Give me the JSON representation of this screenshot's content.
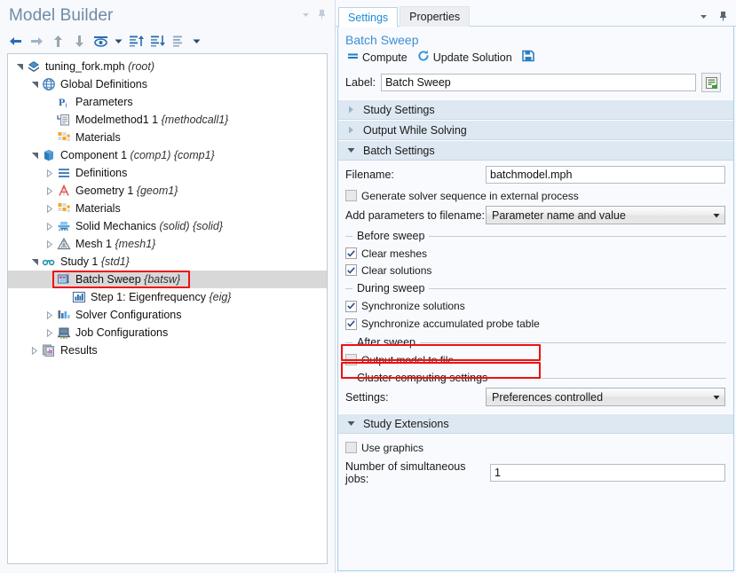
{
  "model_builder": {
    "title": "Model Builder",
    "header_controls": [
      {
        "name": "collapse-menu-icon",
        "glyph": "▼"
      },
      {
        "name": "pin-icon",
        "glyph": "pin"
      }
    ],
    "toolbar": [
      {
        "name": "back-icon",
        "tip": "Back"
      },
      {
        "name": "forward-icon",
        "tip": "Forward"
      },
      {
        "name": "move-up-icon",
        "tip": "Move Up"
      },
      {
        "name": "move-down-icon",
        "tip": "Move Down"
      },
      {
        "name": "show-icon",
        "tip": "Show"
      },
      {
        "name": "show-dropdown-icon",
        "tip": "Show options"
      },
      {
        "name": "expand-all-icon",
        "tip": "Expand All"
      },
      {
        "name": "collapse-all-icon",
        "tip": "Collapse All"
      },
      {
        "name": "tree-options-icon",
        "tip": "Tree options"
      },
      {
        "name": "tree-options-dropdown-icon",
        "tip": "Tree options menu"
      }
    ],
    "tree": [
      {
        "depth": 0,
        "twist": "expanded",
        "icon": "model-root-icon",
        "label": "tuning_fork.mph",
        "tag": "(root)",
        "selected": false,
        "highlight": false
      },
      {
        "depth": 1,
        "twist": "expanded",
        "icon": "global-definitions-icon",
        "label": "Global Definitions",
        "tag": "",
        "selected": false,
        "highlight": false
      },
      {
        "depth": 2,
        "twist": "none",
        "icon": "parameters-icon",
        "label": "Parameters",
        "tag": "",
        "selected": false,
        "highlight": false
      },
      {
        "depth": 2,
        "twist": "none",
        "icon": "method-call-icon",
        "label": "Modelmethod1 1",
        "tag": "{methodcall1}",
        "selected": false,
        "highlight": false
      },
      {
        "depth": 2,
        "twist": "none",
        "icon": "materials-icon",
        "label": "Materials",
        "tag": "",
        "selected": false,
        "highlight": false
      },
      {
        "depth": 1,
        "twist": "expanded",
        "icon": "component-icon",
        "label": "Component 1",
        "tag": "(comp1) {comp1}",
        "selected": false,
        "highlight": false
      },
      {
        "depth": 2,
        "twist": "collapsed",
        "icon": "definitions-icon",
        "label": "Definitions",
        "tag": "",
        "selected": false,
        "highlight": false
      },
      {
        "depth": 2,
        "twist": "collapsed",
        "icon": "geometry-icon",
        "label": "Geometry 1",
        "tag": "{geom1}",
        "selected": false,
        "highlight": false
      },
      {
        "depth": 2,
        "twist": "collapsed",
        "icon": "materials-icon",
        "label": "Materials",
        "tag": "",
        "selected": false,
        "highlight": false
      },
      {
        "depth": 2,
        "twist": "collapsed",
        "icon": "solid-mechanics-icon",
        "label": "Solid Mechanics",
        "tag": "(solid) {solid}",
        "selected": false,
        "highlight": false
      },
      {
        "depth": 2,
        "twist": "collapsed",
        "icon": "mesh-icon",
        "label": "Mesh 1",
        "tag": "{mesh1}",
        "selected": false,
        "highlight": false
      },
      {
        "depth": 1,
        "twist": "expanded",
        "icon": "study-icon",
        "label": "Study 1",
        "tag": "{std1}",
        "selected": false,
        "highlight": false
      },
      {
        "depth": 2,
        "twist": "none",
        "icon": "batch-sweep-icon",
        "label": "Batch Sweep",
        "tag": "{batsw}",
        "selected": true,
        "highlight": true
      },
      {
        "depth": 3,
        "twist": "none",
        "icon": "eigenfrequency-icon",
        "label": "Step 1: Eigenfrequency",
        "tag": "{eig}",
        "selected": false,
        "highlight": false
      },
      {
        "depth": 2,
        "twist": "collapsed",
        "icon": "solver-configurations-icon",
        "label": "Solver Configurations",
        "tag": "",
        "selected": false,
        "highlight": false
      },
      {
        "depth": 2,
        "twist": "collapsed",
        "icon": "job-configurations-icon",
        "label": "Job Configurations",
        "tag": "",
        "selected": false,
        "highlight": false
      },
      {
        "depth": 1,
        "twist": "collapsed",
        "icon": "results-icon",
        "label": "Results",
        "tag": "",
        "selected": false,
        "highlight": false
      }
    ]
  },
  "settings": {
    "tabs": [
      {
        "label": "Settings",
        "active": true
      },
      {
        "label": "Properties",
        "active": false
      }
    ],
    "header_controls": [
      {
        "name": "collapse-menu-icon",
        "glyph": "▼"
      },
      {
        "name": "pin-icon",
        "glyph": "pin"
      }
    ],
    "node_title": "Batch Sweep",
    "actions": [
      {
        "name": "compute-button",
        "label": "Compute",
        "icon": "equals-icon"
      },
      {
        "name": "update-solution-button",
        "label": "Update Solution",
        "icon": "refresh-icon"
      },
      {
        "name": "save-button",
        "label": "",
        "icon": "save-icon"
      }
    ],
    "label_field": {
      "label": "Label:",
      "value": "Batch Sweep",
      "button_icon": "rename-icon"
    },
    "sections": [
      {
        "title": "Study Settings",
        "expanded": false
      },
      {
        "title": "Output While Solving",
        "expanded": false
      },
      {
        "title": "Batch Settings",
        "expanded": true
      },
      {
        "title": "Study Extensions",
        "expanded": true
      }
    ],
    "batch_settings": {
      "filename_label": "Filename:",
      "filename_value": "batchmodel.mph",
      "generate_solver_label": "Generate solver sequence in external process",
      "generate_solver_checked": false,
      "add_params_label": "Add parameters to filename:",
      "add_params_value": "Parameter name and value",
      "group_before_sweep": "Before sweep",
      "clear_meshes_label": "Clear meshes",
      "clear_meshes_checked": true,
      "clear_solutions_label": "Clear solutions",
      "clear_solutions_checked": true,
      "group_during_sweep": "During sweep",
      "sync_solutions_label": "Synchronize solutions",
      "sync_solutions_checked": true,
      "sync_probe_label": "Synchronize accumulated probe table",
      "sync_probe_checked": true,
      "group_after_sweep": "After sweep",
      "output_model_label": "Output model to file",
      "output_model_checked": false,
      "group_cluster": "Cluster computing settings",
      "settings_label": "Settings:",
      "settings_value": "Preferences controlled"
    },
    "study_extensions": {
      "use_graphics_label": "Use graphics",
      "use_graphics_checked": false,
      "jobs_label": "Number of simultaneous jobs:",
      "jobs_value": "1"
    }
  },
  "colors": {
    "accent_blue": "#1b8ed6",
    "title_blue": "#6f8aa8",
    "section_header_bg": "#dee8f2",
    "highlight_red": "#ee1111",
    "selection_gray": "#d8d8d8",
    "panel_bg": "#f8fafd"
  }
}
